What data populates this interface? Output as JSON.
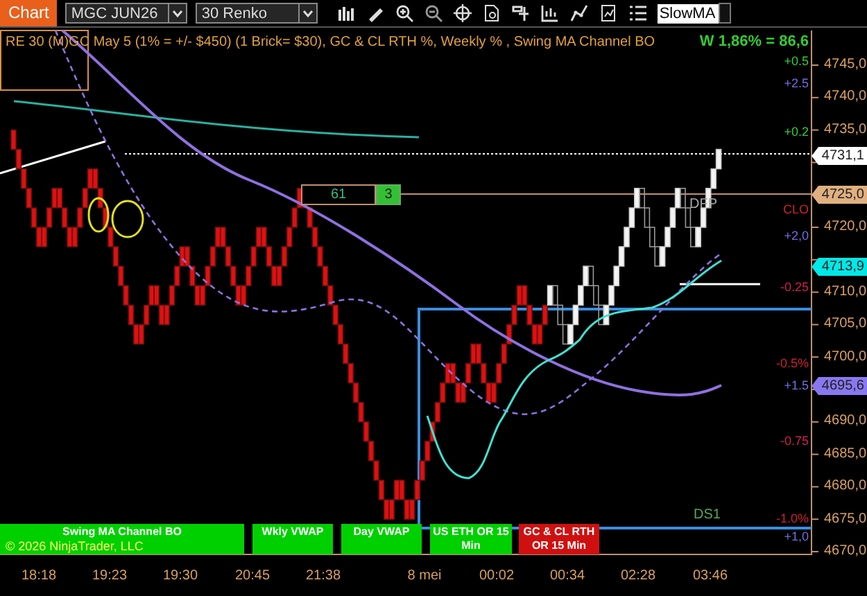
{
  "toolbar": {
    "tab": "Chart",
    "instrument": "MGC JUN26",
    "bar_type": "30 Renko",
    "indicator_field": "SlowMA"
  },
  "chart": {
    "title": "RE 30 (M)GC May 5 (1% = +/- $450) (1 Brick= $30), GC & CL RTH %, Weekly % , Swing MA Channel BO",
    "weekly_stat": "W 1,86% = 86,6",
    "price_axis": [
      "4745,0",
      "4740,0",
      "4735,0",
      "4720,0",
      "4710,0",
      "4705,0",
      "4700,0",
      "4690,0",
      "4685,0",
      "4680,0",
      "4675,0",
      "4670,0"
    ],
    "price_flags": [
      {
        "text": "4731,1",
        "color": "#ffffff"
      },
      {
        "text": "4725,0",
        "color": "#e0b080"
      },
      {
        "text": "4713,9",
        "color": "#00e8e8"
      },
      {
        "text": "4695,6",
        "color": "#8878f0"
      }
    ],
    "level_labels": [
      {
        "text": "+0.5",
        "color": "#33cc33"
      },
      {
        "text": "+2.5",
        "color": "#7070e0"
      },
      {
        "text": "+0.2",
        "color": "#33cc33"
      },
      {
        "text": "CLO",
        "color": "#d02030"
      },
      {
        "text": "+2,0",
        "color": "#7070e0"
      },
      {
        "text": "-0.25",
        "color": "#d02050"
      },
      {
        "text": "-0.5%",
        "color": "#d02030"
      },
      {
        "text": "+1.5",
        "color": "#7070e0"
      },
      {
        "text": "-0.75",
        "color": "#d02050"
      },
      {
        "text": "-1.0%",
        "color": "#d02030"
      },
      {
        "text": "+1,0",
        "color": "#7070e0"
      }
    ],
    "marker_box": {
      "value": "61",
      "count": "3"
    },
    "annotations": [
      "DFP",
      "DS1"
    ],
    "panels": [
      {
        "title": "Swing MA Channel BO",
        "color": "#00d000"
      },
      {
        "title": "Wkly VWAP",
        "color": "#00d000"
      },
      {
        "title": "Day VWAP",
        "color": "#00d000"
      },
      {
        "title": "US ETH OR 15 Min",
        "color": "#00d000"
      },
      {
        "title": "GC & CL RTH OR 15 Min",
        "color": "#d01010"
      }
    ],
    "copyright": "© 2026 NinjaTrader, LLC",
    "time_axis": [
      "18:18",
      "19:23",
      "19:30",
      "20:45",
      "21:38",
      "8 mei",
      "00:02",
      "00:34",
      "02:28",
      "03:46"
    ]
  }
}
